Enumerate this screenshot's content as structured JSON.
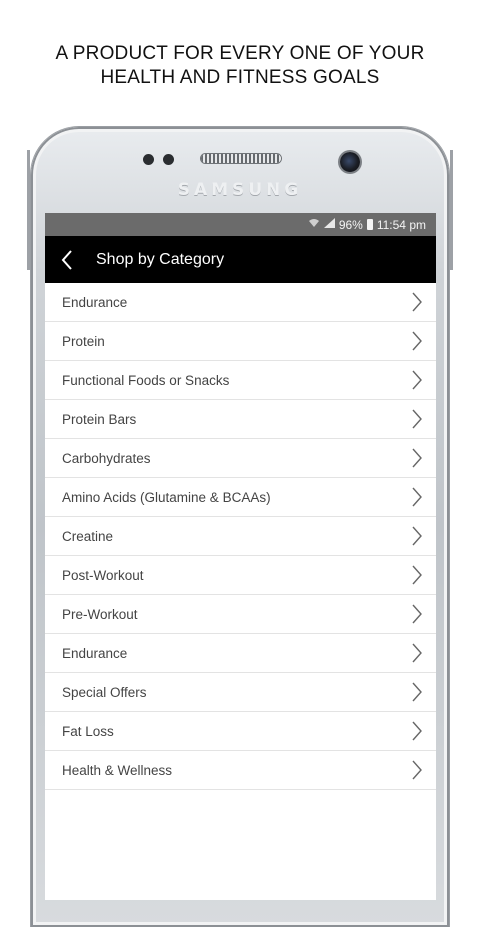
{
  "promo": {
    "line1": "A PRODUCT FOR EVERY ONE OF YOUR",
    "line2": "HEALTH AND FITNESS GOALS"
  },
  "device": {
    "brand": "SAMSUNG"
  },
  "status_bar": {
    "battery": "96%",
    "time": "11:54 pm"
  },
  "app_bar": {
    "title": "Shop by Category"
  },
  "categories": [
    {
      "label": "Endurance"
    },
    {
      "label": "Protein"
    },
    {
      "label": "Functional Foods or Snacks"
    },
    {
      "label": "Protein Bars"
    },
    {
      "label": "Carbohydrates"
    },
    {
      "label": "Amino Acids (Glutamine & BCAAs)"
    },
    {
      "label": "Creatine"
    },
    {
      "label": "Post-Workout"
    },
    {
      "label": "Pre-Workout"
    },
    {
      "label": "Endurance"
    },
    {
      "label": "Special Offers"
    },
    {
      "label": "Fat Loss"
    },
    {
      "label": "Health & Wellness"
    }
  ],
  "icons": {
    "back": "chevron-left-icon",
    "row": "chevron-right-icon"
  },
  "colors": {
    "status_bar": "#6b6b6b",
    "app_bar": "#000000",
    "row_text": "#444444",
    "divider": "#e3e3e3"
  }
}
